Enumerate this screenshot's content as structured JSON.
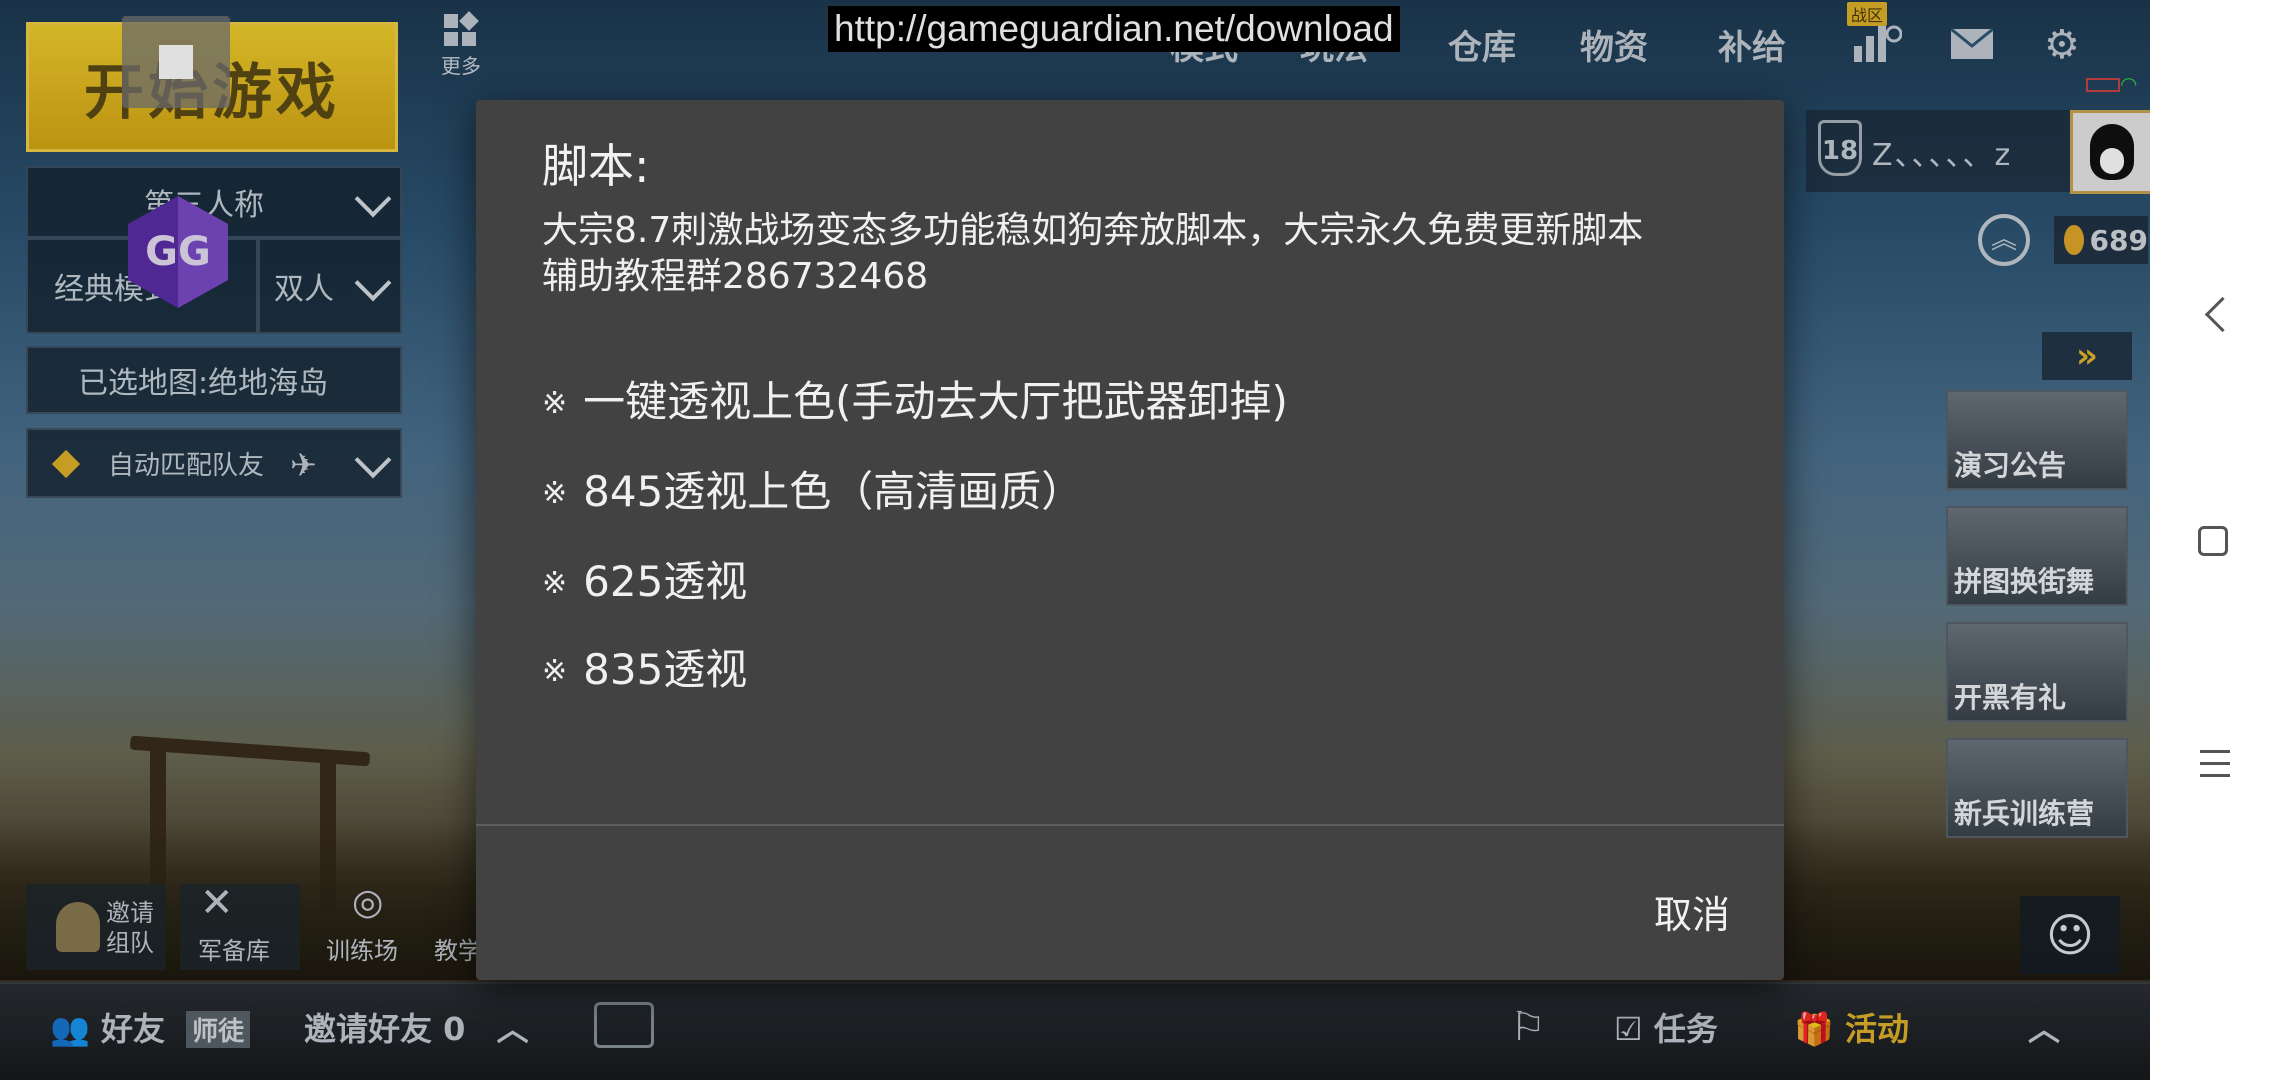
{
  "overlay_url": "http://gameguardian.net/download",
  "game": {
    "start_button": "开始游戏",
    "more_label": "更多",
    "perspective": "第三人称",
    "mode": "经典模式",
    "team_mode": "双人",
    "map_label": "已选地图:绝地海岛",
    "auto_match": "自动匹配队友",
    "gg_label": "GG",
    "nav": {
      "mode_tab": "模式",
      "events_tab": "玩法",
      "warehouse": "仓库",
      "supplies": "物资",
      "resupply": "补给",
      "zone_badge": "战区"
    },
    "player": {
      "level": "18",
      "name": "Z、、、、、z",
      "coins": "689"
    },
    "promos": [
      {
        "label": "演习公告"
      },
      {
        "label": "拼图换街舞"
      },
      {
        "label": "开黑有礼"
      },
      {
        "label": "新兵训练营"
      }
    ],
    "squad_buttons": {
      "invite": "邀请\n组队",
      "armory": "军备库",
      "training": "训练场",
      "tutorial": "教学"
    },
    "bottom_bar": {
      "friends": "好友",
      "mentor_tag": "师徒",
      "invite_friends": "邀请好友 0",
      "tasks": "任务",
      "events": "活动"
    }
  },
  "dialog": {
    "title": "脚本:",
    "description_line1": "大宗8.7刺激战场变态多功能稳如狗奔放脚本，大宗永久免费更新脚本",
    "description_line2": "辅助教程群286732468",
    "option_mark": "※",
    "options": [
      "一键透视上色(手动去大厅把武器卸掉)",
      "845透视上色（高清画质）",
      "625透视",
      "835透视"
    ],
    "cancel_label": "取消"
  },
  "colors": {
    "dialog_bg": "#424242",
    "dialog_text": "#f0f0f0",
    "accent_gold": "#e2b32a"
  }
}
